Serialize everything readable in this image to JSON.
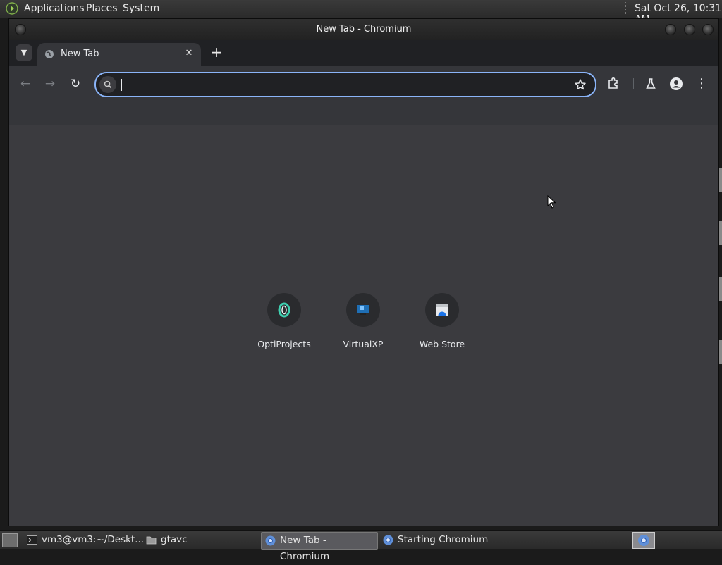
{
  "top_panel": {
    "menus": [
      "Applications",
      "Places",
      "System"
    ],
    "clock": "Sat Oct 26, 10:31 AM"
  },
  "window": {
    "title": "New Tab - Chromium"
  },
  "tabs": [
    {
      "title": "New Tab",
      "active": true
    }
  ],
  "toolbar": {
    "omnibox_value": "",
    "accent_color": "#8ab4f8"
  },
  "shortcuts": [
    {
      "label": "OptiProjects",
      "icon": "optiprojects-icon"
    },
    {
      "label": "VirtualXP",
      "icon": "virtualxp-icon"
    },
    {
      "label": "Web Store",
      "icon": "web-store-icon"
    }
  ],
  "taskbar": {
    "items": [
      {
        "label": "vm3@vm3:~/Deskt...",
        "icon": "terminal-icon",
        "active": false
      },
      {
        "label": "gtavc",
        "icon": "folder-icon",
        "active": false
      },
      {
        "label": "New Tab - Chromium",
        "icon": "chromium-icon",
        "active": true
      },
      {
        "label": "Starting Chromium",
        "icon": "chromium-icon",
        "active": false
      }
    ]
  }
}
